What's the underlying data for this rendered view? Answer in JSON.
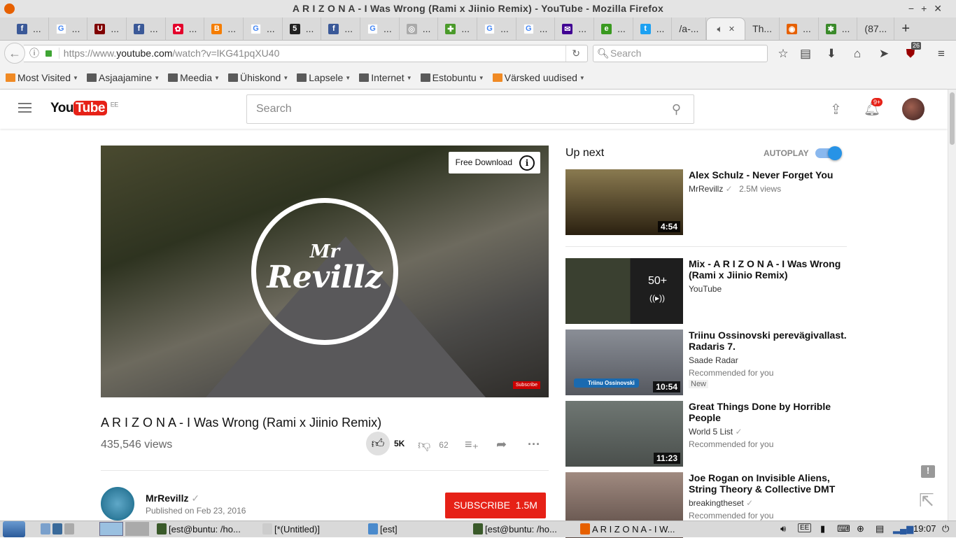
{
  "window": {
    "title": "A R I Z O N A - I Was Wrong (Rami x Jiinio Remix) - YouTube - Mozilla Firefox"
  },
  "tabs": [
    {
      "icon": "facebook-icon",
      "label": "...",
      "color": "#3b5998",
      "glyph": "f"
    },
    {
      "icon": "google-icon",
      "label": "...",
      "color": "#4285f4",
      "glyph": "G"
    },
    {
      "icon": "ublock-icon",
      "label": "...",
      "color": "#800000",
      "glyph": "U"
    },
    {
      "icon": "facebook-icon",
      "label": "...",
      "color": "#3b5998",
      "glyph": "f"
    },
    {
      "icon": "huawei-icon",
      "label": "...",
      "color": "#e4002b",
      "glyph": "✿"
    },
    {
      "icon": "blogger-icon",
      "label": "...",
      "color": "#f57d00",
      "glyph": "B"
    },
    {
      "icon": "google-icon",
      "label": "...",
      "color": "#4285f4",
      "glyph": "G"
    },
    {
      "icon": "five-icon",
      "label": "...",
      "color": "#222",
      "glyph": "5"
    },
    {
      "icon": "facebook-icon",
      "label": "...",
      "color": "#3b5998",
      "glyph": "f"
    },
    {
      "icon": "google-icon",
      "label": "...",
      "color": "#4285f4",
      "glyph": "G"
    },
    {
      "icon": "leaf-icon",
      "label": "...",
      "color": "#aaa",
      "glyph": "◎"
    },
    {
      "icon": "puzzle-icon",
      "label": "...",
      "color": "#4a9a2a",
      "glyph": "✚"
    },
    {
      "icon": "google-icon",
      "label": "...",
      "color": "#4285f4",
      "glyph": "G"
    },
    {
      "icon": "google-icon",
      "label": "...",
      "color": "#4285f4",
      "glyph": "G"
    },
    {
      "icon": "mail-icon",
      "label": "...",
      "color": "#410093",
      "glyph": "✉"
    },
    {
      "icon": "green-app-icon",
      "label": "...",
      "color": "#3a9a20",
      "glyph": "e"
    },
    {
      "icon": "twitter-icon",
      "label": "...",
      "color": "#1da1f2",
      "glyph": "t"
    },
    {
      "icon": "",
      "label": "/a-...",
      "color": "",
      "glyph": ""
    },
    {
      "icon": "speaker-icon",
      "label": "",
      "color": "",
      "glyph": "",
      "active": true
    },
    {
      "icon": "",
      "label": "Th...",
      "color": "",
      "glyph": ""
    },
    {
      "icon": "firefox-icon",
      "label": "...",
      "color": "#e66000",
      "glyph": "◉"
    },
    {
      "icon": "bug-icon",
      "label": "...",
      "color": "#3a8a2a",
      "glyph": "✱"
    },
    {
      "icon": "",
      "label": "(87...",
      "color": "",
      "glyph": ""
    }
  ],
  "nav": {
    "url_prefix": "https://www.",
    "url_domain": "youtube.com",
    "url_path": "/watch?v=lKG41pqXU40",
    "search_placeholder": "Search",
    "ublock_count": "26"
  },
  "bookmarks": [
    {
      "label": "Most Visited",
      "icon": "most-visited-icon"
    },
    {
      "label": "Asjaajamine",
      "icon": "folder-icon"
    },
    {
      "label": "Meedia",
      "icon": "folder-icon"
    },
    {
      "label": "Ühiskond",
      "icon": "folder-icon"
    },
    {
      "label": "Lapsele",
      "icon": "folder-icon"
    },
    {
      "label": "Internet",
      "icon": "folder-icon"
    },
    {
      "label": "Estobuntu",
      "icon": "folder-icon"
    },
    {
      "label": "Värsked uudised",
      "icon": "rss-icon"
    }
  ],
  "youtube": {
    "logo_you": "You",
    "logo_tube": "Tube",
    "region": "EE",
    "search_placeholder": "Search",
    "notifications": "9+",
    "brand_color": "#e62117"
  },
  "video": {
    "overlay_logo": "Mr Revillz",
    "free_download": "Free Download",
    "info": "i",
    "subscribe_watermark": "Subscribe",
    "title": "A R I Z O N A - I Was Wrong (Rami x Jiinio Remix)",
    "views": "435,546 views",
    "likes": "5K",
    "dislikes": "62",
    "channel": "MrRevillz",
    "published": "Published on Feb 23, 2016",
    "subscribe_label": "SUBSCRIBE",
    "subscriber_count": "1.5M"
  },
  "sidebar": {
    "up_next": "Up next",
    "autoplay": "AUTOPLAY",
    "autoplay_on": true,
    "items": [
      {
        "title": "Alex Schulz - Never Forget You",
        "channel": "MrRevillz",
        "verified": true,
        "meta": "2.5M views",
        "duration": "4:54"
      },
      {
        "title": "Mix - A R I Z O N A - I Was Wrong (Rami x Jiinio Remix)",
        "channel": "YouTube",
        "mix_count": "50+"
      },
      {
        "title": "Triinu Ossinovski perevägivallast. Radaris 7.",
        "channel": "Saade Radar",
        "meta": "Recommended for you",
        "badge": "New",
        "duration": "10:54",
        "thumb_caption": "Triinu Ossinovski"
      },
      {
        "title": "Great Things Done by Horrible People",
        "channel": "World 5 List",
        "verified": true,
        "meta": "Recommended for you",
        "duration": "11:23"
      },
      {
        "title": "Joe Rogan on Invisible Aliens, String Theory & Collective DMT",
        "channel": "breakingtheset",
        "verified": true,
        "meta": "Recommended for you"
      }
    ]
  },
  "taskbar": {
    "tasks": [
      "[est@buntu: /ho...",
      "[*(Untitled)]",
      "[est]",
      "[est@buntu: /ho...",
      "A R I Z O N A - I W..."
    ],
    "keyboard": "EE",
    "clock": "19:07"
  }
}
